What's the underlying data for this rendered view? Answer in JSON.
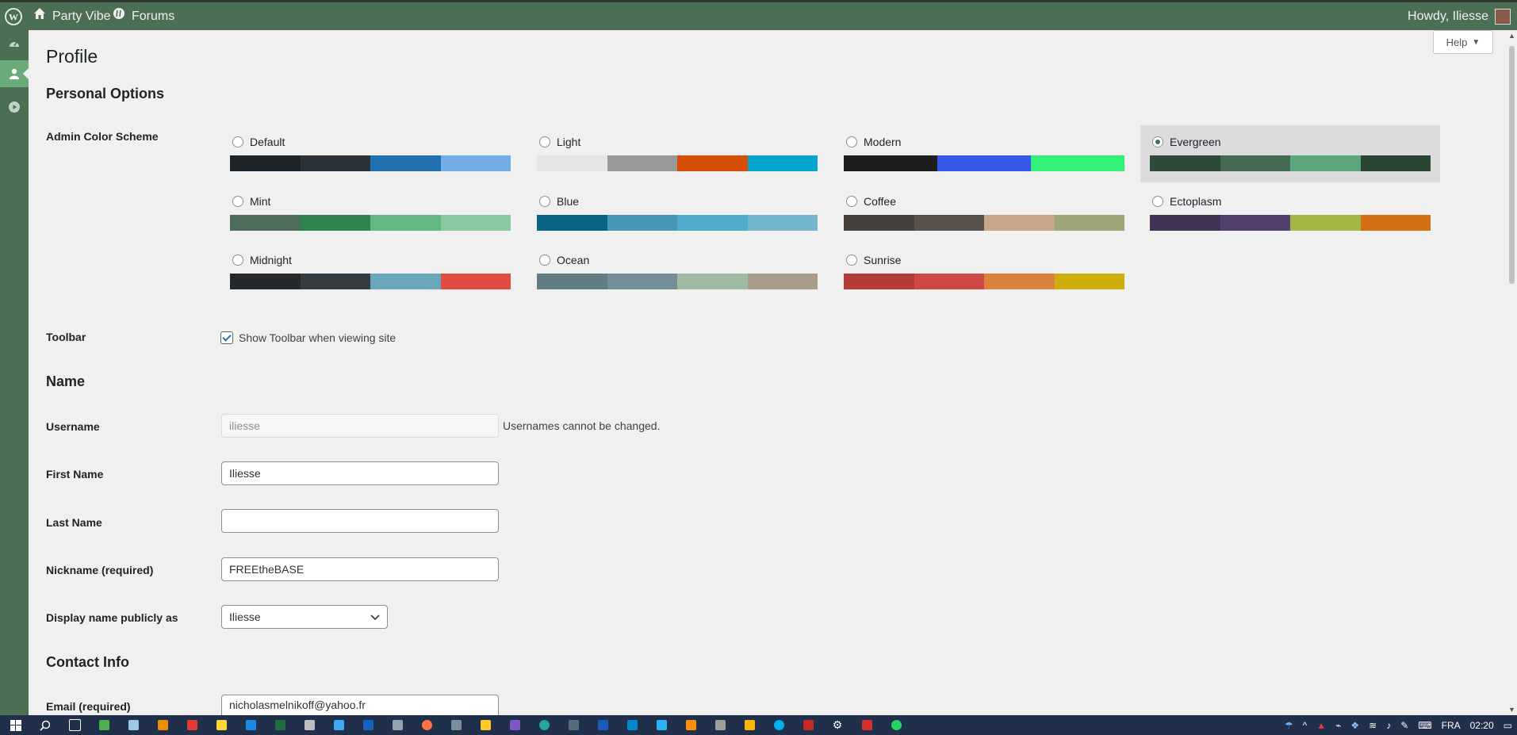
{
  "adminbar": {
    "site_name": "Party Vibe",
    "forums": "Forums",
    "howdy": "Howdy, Iliesse"
  },
  "sidebar": {
    "icons": [
      "dashboard-icon",
      "profile-icon",
      "media-play-icon"
    ],
    "current": "profile-icon"
  },
  "help_label": "Help",
  "page_title": "Profile",
  "personal_options": {
    "heading": "Personal Options",
    "color_scheme_label": "Admin Color Scheme",
    "schemes": [
      {
        "name": "Default",
        "colors": [
          "#1d2327",
          "#2c3338",
          "#2271b1",
          "#72aee6"
        ],
        "selected": false
      },
      {
        "name": "Light",
        "colors": [
          "#e5e5e5",
          "#999999",
          "#d64e07",
          "#04a4cc"
        ],
        "selected": false
      },
      {
        "name": "Modern",
        "colors": [
          "#1e1e1e",
          "#3858e9",
          "#33f078"
        ],
        "selected": false
      },
      {
        "name": "Evergreen",
        "colors": [
          "#2f4a39",
          "#446a51",
          "#5ba97a",
          "#2b4533"
        ],
        "selected": true
      },
      {
        "name": "Mint",
        "colors": [
          "#4f6d5b",
          "#2f8450",
          "#64b883",
          "#8ac9a0"
        ],
        "selected": false
      },
      {
        "name": "Blue",
        "colors": [
          "#096484",
          "#4796b3",
          "#52accc",
          "#74b6ce"
        ],
        "selected": false
      },
      {
        "name": "Coffee",
        "colors": [
          "#46403c",
          "#59524c",
          "#c7a589",
          "#9ea476"
        ],
        "selected": false
      },
      {
        "name": "Ectoplasm",
        "colors": [
          "#413256",
          "#523f6d",
          "#a3b745",
          "#d46f15"
        ],
        "selected": false
      },
      {
        "name": "Midnight",
        "colors": [
          "#25282b",
          "#363b3f",
          "#69a8bb",
          "#e14d43"
        ],
        "selected": false
      },
      {
        "name": "Ocean",
        "colors": [
          "#627c83",
          "#738e96",
          "#9ebaa0",
          "#aa9d88"
        ],
        "selected": false
      },
      {
        "name": "Sunrise",
        "colors": [
          "#b43c38",
          "#cf4944",
          "#dd823b",
          "#ccaf0b"
        ],
        "selected": false
      }
    ],
    "toolbar_label": "Toolbar",
    "toolbar_checkbox": "Show Toolbar when viewing site",
    "toolbar_checked": true
  },
  "name_section": {
    "heading": "Name",
    "username_label": "Username",
    "username_value": "iliesse",
    "username_note": "Usernames cannot be changed.",
    "first_name_label": "First Name",
    "first_name_value": "Iliesse",
    "last_name_label": "Last Name",
    "last_name_value": "",
    "nickname_label": "Nickname (required)",
    "nickname_value": "FREEtheBASE",
    "display_label": "Display name publicly as",
    "display_value": "Iliesse"
  },
  "contact": {
    "heading": "Contact Info",
    "email_label": "Email (required)",
    "email_value": "nicholasmelnikoff@yahoo.fr"
  },
  "taskbar": {
    "lang": "FRA",
    "time": "02:20"
  }
}
